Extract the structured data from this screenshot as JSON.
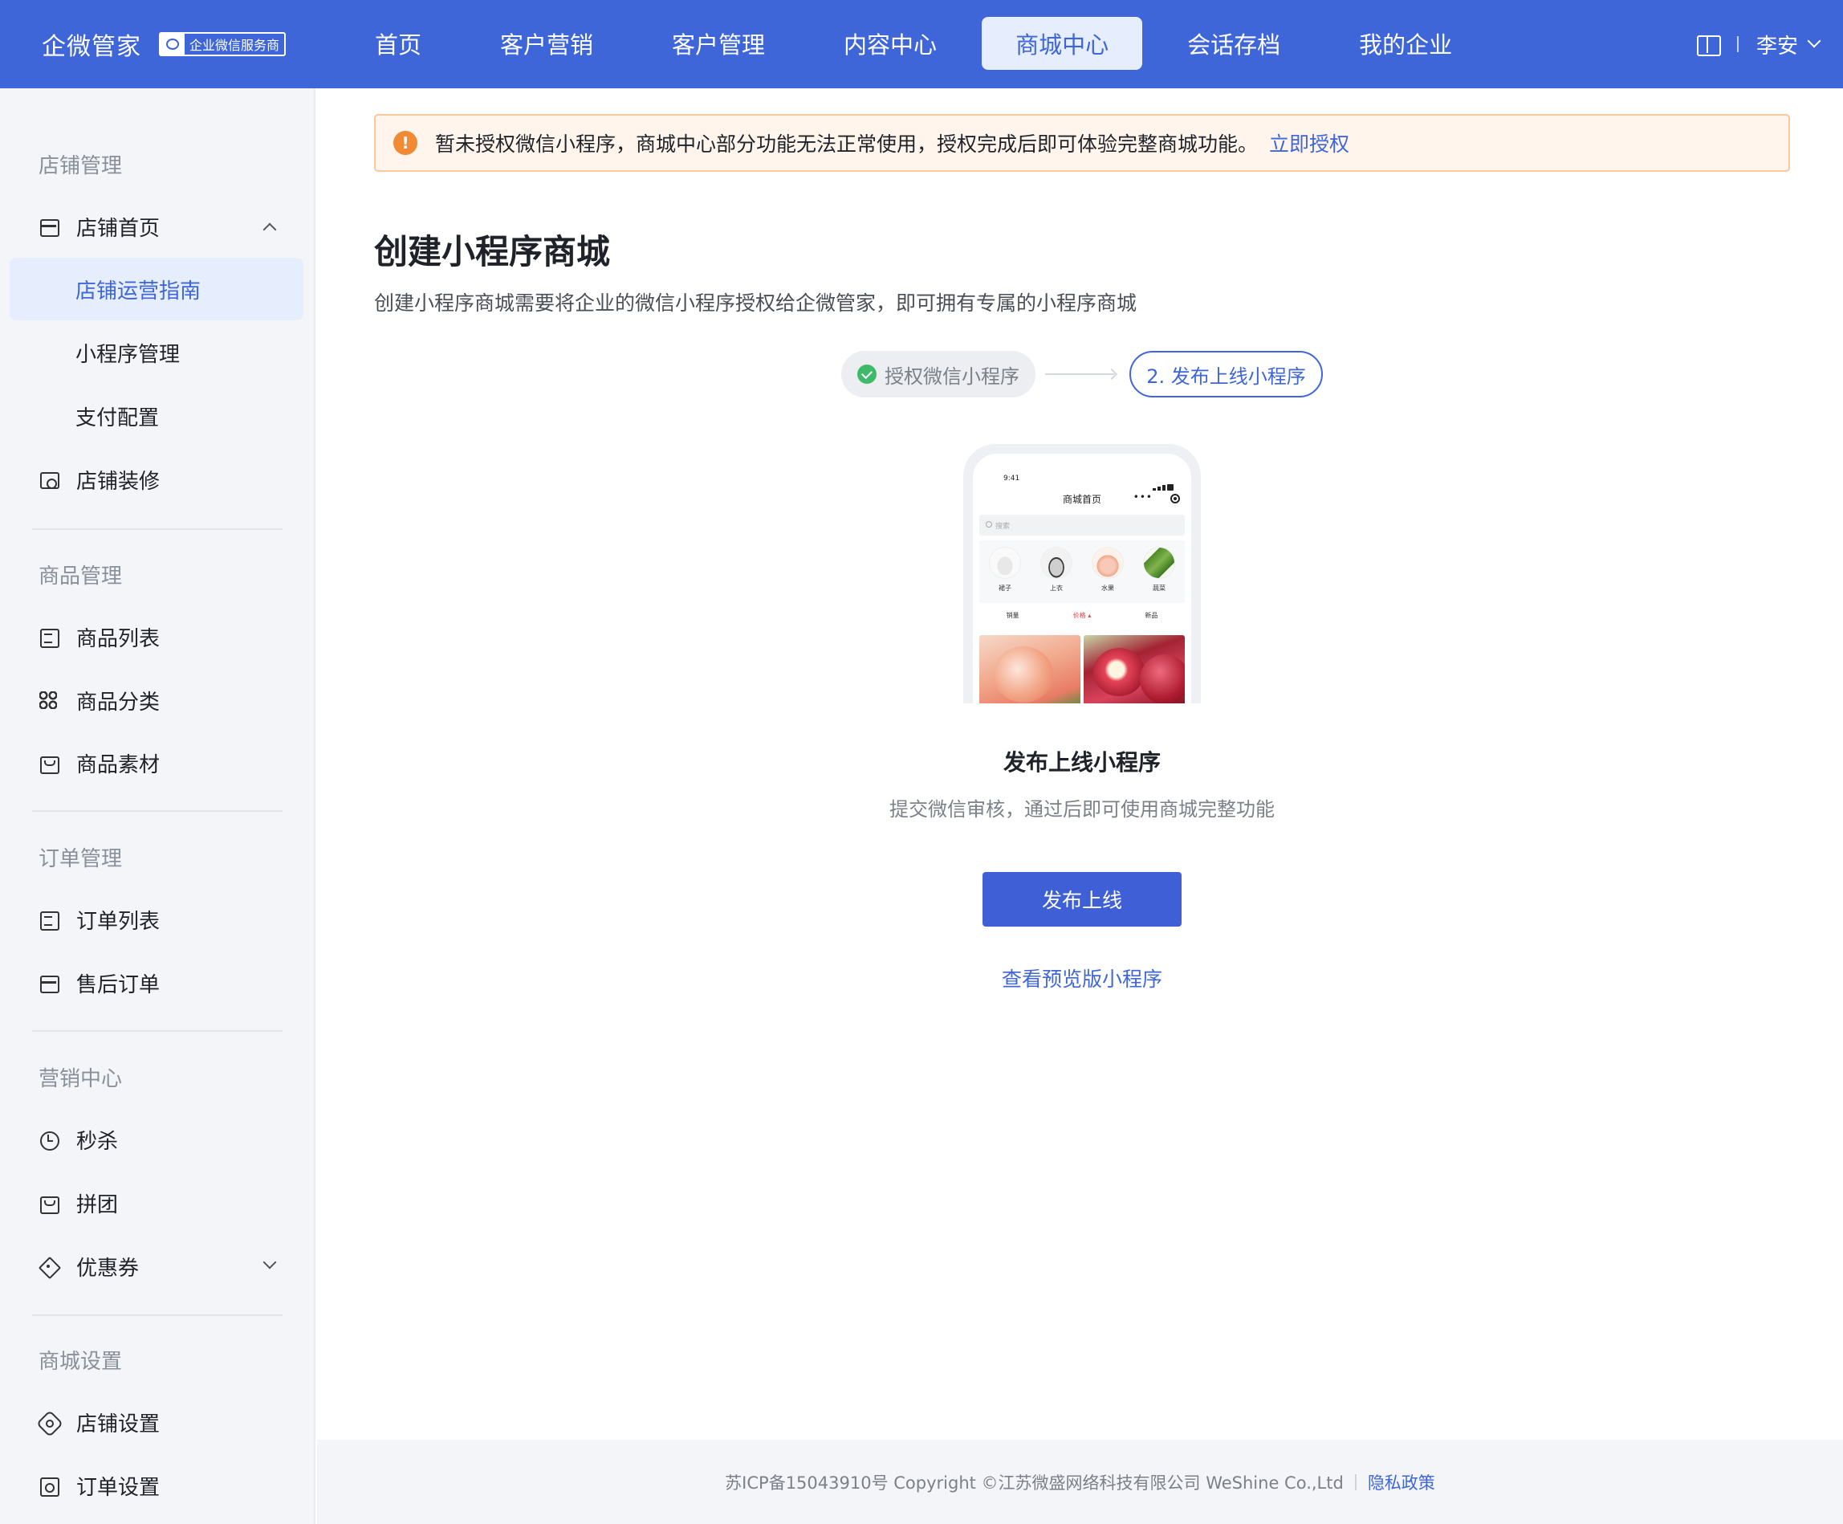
{
  "header": {
    "brand_name": "企微管家",
    "brand_badge": "企业微信服务商",
    "nav": [
      {
        "label": "首页",
        "active": false
      },
      {
        "label": "客户营销",
        "active": false
      },
      {
        "label": "客户管理",
        "active": false
      },
      {
        "label": "内容中心",
        "active": false
      },
      {
        "label": "商城中心",
        "active": true
      },
      {
        "label": "会话存档",
        "active": false
      },
      {
        "label": "我的企业",
        "active": false
      }
    ],
    "user_name": "李安"
  },
  "sidebar": {
    "groups": [
      {
        "title": "店铺管理"
      },
      {
        "title": "商品管理"
      },
      {
        "title": "订单管理"
      },
      {
        "title": "营销中心"
      },
      {
        "title": "商城设置"
      }
    ],
    "items": {
      "shop_home": "店铺首页",
      "shop_guide": "店铺运营指南",
      "miniapp_manage": "小程序管理",
      "payment_config": "支付配置",
      "shop_decor": "店铺装修",
      "product_list": "商品列表",
      "product_category": "商品分类",
      "product_material": "商品素材",
      "order_list": "订单列表",
      "aftersale_order": "售后订单",
      "flash_sale": "秒杀",
      "group_buy": "拼团",
      "coupon": "优惠券",
      "shop_settings": "店铺设置",
      "order_settings": "订单设置"
    },
    "active_item": "店铺运营指南"
  },
  "alert": {
    "icon": "info-icon",
    "text": "暂未授权微信小程序，商城中心部分功能无法正常使用，授权完成后即可体验完整商城功能。",
    "link": "立即授权",
    "color": "#f08a34"
  },
  "main": {
    "title": "创建小程序商城",
    "description": "创建小程序商城需要将企业的微信小程序授权给企微管家，即可拥有专属的小程序商城",
    "steps": [
      {
        "label": "授权微信小程序",
        "done": true
      },
      {
        "label": "2. 发布上线小程序",
        "done": false
      }
    ],
    "phone": {
      "time": "9:41",
      "title": "商城首页",
      "search_placeholder": "搜索",
      "categories": [
        "裙子",
        "上衣",
        "水果",
        "蔬菜"
      ],
      "tabs": [
        "销量",
        "价格",
        "新品"
      ],
      "highlight_tab": "价格"
    },
    "section_title": "发布上线小程序",
    "section_desc": "提交微信审核，通过后即可使用商城完整功能",
    "publish_button": "发布上线",
    "preview_link": "查看预览版小程序"
  },
  "footer": {
    "copyright": "苏ICP备15043910号 Copyright ©江苏微盛网络科技有限公司 WeShine Co.,Ltd",
    "privacy": "隐私政策"
  },
  "colors": {
    "primary": "#3f66d8",
    "success": "#3fba6a"
  }
}
